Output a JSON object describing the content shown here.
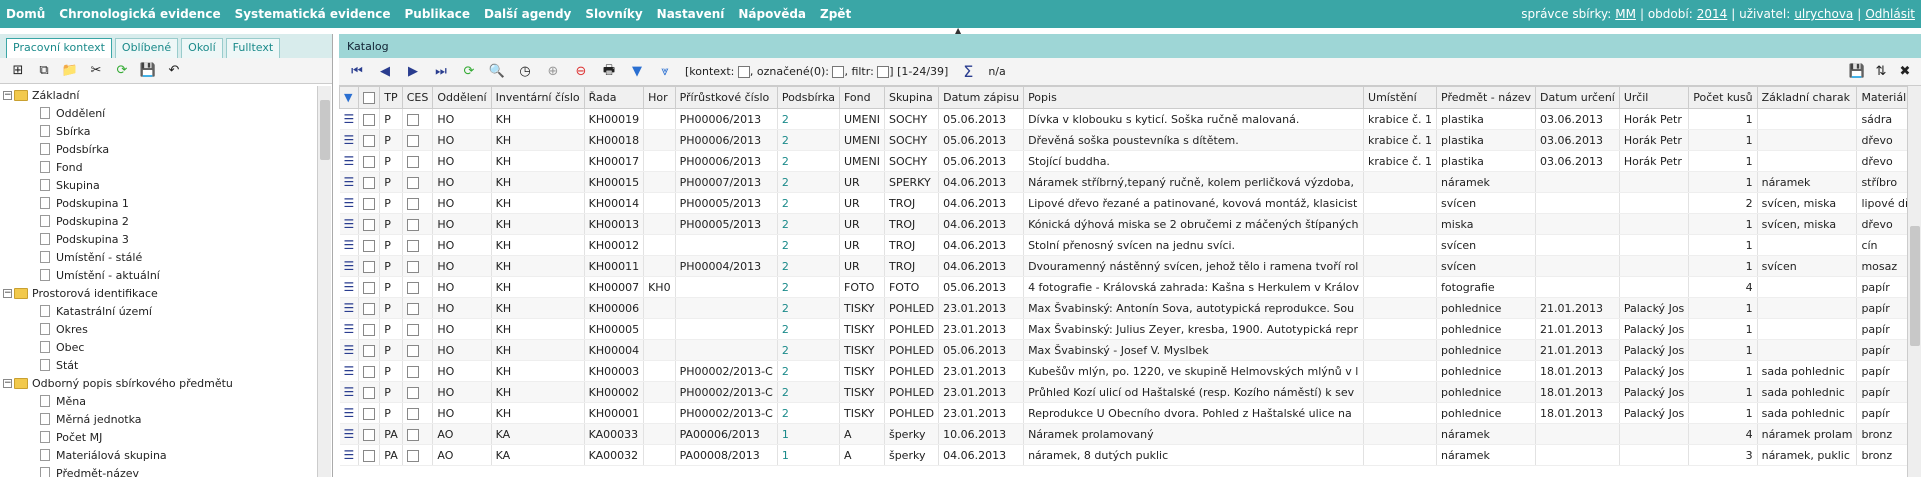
{
  "nav": {
    "items": [
      "Domů",
      "Chronologická evidence",
      "Systematická evidence",
      "Publikace",
      "Další agendy",
      "Slovníky",
      "Nastavení",
      "Nápověda",
      "Zpět"
    ],
    "admin_label": "správce sbírky:",
    "admin_value": "MM",
    "period_label": "| období:",
    "period_value": "2014",
    "user_label": "| uživatel:",
    "user_value": "ulrychova",
    "logout": "Odhlásit"
  },
  "left": {
    "tabs": [
      "Pracovní kontext",
      "Oblíbené",
      "Okolí",
      "Fulltext"
    ],
    "tree": [
      {
        "label": "Základní",
        "type": "folder"
      },
      {
        "label": "Oddělení",
        "type": "doc"
      },
      {
        "label": "Sbírka",
        "type": "doc"
      },
      {
        "label": "Podsbírka",
        "type": "doc"
      },
      {
        "label": "Fond",
        "type": "doc"
      },
      {
        "label": "Skupina",
        "type": "doc"
      },
      {
        "label": "Podskupina 1",
        "type": "doc"
      },
      {
        "label": "Podskupina 2",
        "type": "doc"
      },
      {
        "label": "Podskupina 3",
        "type": "doc"
      },
      {
        "label": "Umístění - stálé",
        "type": "doc"
      },
      {
        "label": "Umístění - aktuální",
        "type": "doc"
      },
      {
        "label": "Prostorová identifikace",
        "type": "folder"
      },
      {
        "label": "Katastrální území",
        "type": "doc"
      },
      {
        "label": "Okres",
        "type": "doc"
      },
      {
        "label": "Obec",
        "type": "doc"
      },
      {
        "label": "Stát",
        "type": "doc"
      },
      {
        "label": "Odborný popis sbírkového předmětu",
        "type": "folder"
      },
      {
        "label": "Měna",
        "type": "doc"
      },
      {
        "label": "Měrná jednotka",
        "type": "doc"
      },
      {
        "label": "Počet MJ",
        "type": "doc"
      },
      {
        "label": "Materiálová skupina",
        "type": "doc"
      },
      {
        "label": "Předmět-název",
        "type": "doc"
      }
    ]
  },
  "right": {
    "title": "Katalog",
    "toolbar_text": "[kontext:",
    "marked_text": ", označené(0):",
    "filter_text": ", filtr:",
    "range_text": "] [1-24/39]",
    "sum_text": "n/a",
    "columns": [
      "",
      "",
      "TP",
      "CES",
      "Oddělení",
      "Inventární číslo",
      "Řada",
      "Hor",
      "Přírůstkové číslo",
      "Podsbírka",
      "Fond",
      "Skupina",
      "Datum zápisu",
      "Popis",
      "Umístění",
      "Předmět - název",
      "Datum určení",
      "Určil",
      "Počet kusů",
      "Základní charak",
      "Materiál"
    ],
    "rows": [
      [
        "P",
        "HO",
        "KH",
        "KH00019",
        "",
        "PH00006/2013",
        "2",
        "UMENI",
        "SOCHY",
        "05.06.2013",
        "Dívka v klobouku s kyticí. Soška ručně malovaná.",
        "krabice č. 1",
        "plastika",
        "03.06.2013",
        "Horák Petr",
        "1",
        "",
        "sádra"
      ],
      [
        "P",
        "HO",
        "KH",
        "KH00018",
        "",
        "PH00006/2013",
        "2",
        "UMENI",
        "SOCHY",
        "05.06.2013",
        "Dřevěná soška poustevníka s dítětem.",
        "krabice č. 1",
        "plastika",
        "03.06.2013",
        "Horák Petr",
        "1",
        "",
        "dřevo"
      ],
      [
        "P",
        "HO",
        "KH",
        "KH00017",
        "",
        "PH00006/2013",
        "2",
        "UMENI",
        "SOCHY",
        "05.06.2013",
        "Stojící buddha.",
        "krabice č. 1",
        "plastika",
        "03.06.2013",
        "Horák Petr",
        "1",
        "",
        "dřevo"
      ],
      [
        "P",
        "HO",
        "KH",
        "KH00015",
        "",
        "PH00007/2013",
        "2",
        "UR",
        "SPERKY",
        "04.06.2013",
        "Náramek stříbrný,tepaný ručně, kolem perličková výzdoba,",
        "",
        "náramek",
        "",
        "",
        "1",
        "náramek",
        "stříbro"
      ],
      [
        "P",
        "HO",
        "KH",
        "KH00014",
        "",
        "PH00005/2013",
        "2",
        "UR",
        "TROJ",
        "04.06.2013",
        "Lipové dřevo řezané a patinované, kovová montáž, klasicist",
        "",
        "svícen",
        "",
        "",
        "2",
        "svícen, miska",
        "lipové dř"
      ],
      [
        "P",
        "HO",
        "KH",
        "KH00013",
        "",
        "PH00005/2013",
        "2",
        "UR",
        "TROJ",
        "04.06.2013",
        "Kónická dýhová miska se 2 obručemi z máčených štípaných",
        "",
        "miska",
        "",
        "",
        "1",
        "svícen, miska",
        "dřevo"
      ],
      [
        "P",
        "HO",
        "KH",
        "KH00012",
        "",
        "",
        "2",
        "UR",
        "TROJ",
        "04.06.2013",
        "Stolní přenosný svícen na jednu svíci.",
        "",
        "svícen",
        "",
        "",
        "1",
        "",
        "cín"
      ],
      [
        "P",
        "HO",
        "KH",
        "KH00011",
        "",
        "PH00004/2013",
        "2",
        "UR",
        "TROJ",
        "04.06.2013",
        "Dvouramenný nástěnný svícen, jehož tělo i ramena tvoří rol",
        "",
        "svícen",
        "",
        "",
        "1",
        "svícen",
        "mosaz"
      ],
      [
        "P",
        "HO",
        "KH",
        "KH00007",
        "KH0",
        "",
        "2",
        "FOTO",
        "FOTO",
        "05.06.2013",
        "4 fotografie - Královská zahrada: Kašna s Herkulem v Králov",
        "",
        "fotografie",
        "",
        "",
        "4",
        "",
        "papír"
      ],
      [
        "P",
        "HO",
        "KH",
        "KH00006",
        "",
        "",
        "2",
        "TISKY",
        "POHLED",
        "23.01.2013",
        "Max Švabinský: Antonín Sova, autotypická reprodukce. Sou",
        "",
        "pohlednice",
        "21.01.2013",
        "Palacký Jos",
        "1",
        "",
        "papír"
      ],
      [
        "P",
        "HO",
        "KH",
        "KH00005",
        "",
        "",
        "2",
        "TISKY",
        "POHLED",
        "23.01.2013",
        "Max Švabinský: Julius Zeyer, kresba, 1900. Autotypická repr",
        "",
        "pohlednice",
        "21.01.2013",
        "Palacký Jos",
        "1",
        "",
        "papír"
      ],
      [
        "P",
        "HO",
        "KH",
        "KH00004",
        "",
        "",
        "2",
        "TISKY",
        "POHLED",
        "05.06.2013",
        "Max Švabinský - Josef V. Myslbek",
        "",
        "pohlednice",
        "21.01.2013",
        "Palacký Jos",
        "1",
        "",
        "papír"
      ],
      [
        "P",
        "HO",
        "KH",
        "KH00003",
        "",
        "PH00002/2013-C",
        "2",
        "TISKY",
        "POHLED",
        "23.01.2013",
        "Kubešův mlýn, po. 1220, ve skupině Helmovských mlýnů v l",
        "",
        "pohlednice",
        "18.01.2013",
        "Palacký Jos",
        "1",
        "sada pohlednic",
        "papír"
      ],
      [
        "P",
        "HO",
        "KH",
        "KH00002",
        "",
        "PH00002/2013-C",
        "2",
        "TISKY",
        "POHLED",
        "23.01.2013",
        "Průhled Kozí ulicí od Haštalské (resp. Kozího náměstí) k sev",
        "",
        "pohlednice",
        "18.01.2013",
        "Palacký Jos",
        "1",
        "sada pohlednic",
        "papír"
      ],
      [
        "P",
        "HO",
        "KH",
        "KH00001",
        "",
        "PH00002/2013-C",
        "2",
        "TISKY",
        "POHLED",
        "23.01.2013",
        "Reprodukce U Obecního dvora. Pohled z Haštalské ulice na",
        "",
        "pohlednice",
        "18.01.2013",
        "Palacký Jos",
        "1",
        "sada pohlednic",
        "papír"
      ],
      [
        "PA",
        "AO",
        "KA",
        "KA00033",
        "",
        "PA00006/2013",
        "1",
        "A",
        "šperky",
        "10.06.2013",
        "Náramek prolamovaný",
        "",
        "náramek",
        "",
        "",
        "4",
        "náramek prolam",
        "bronz"
      ],
      [
        "PA",
        "AO",
        "KA",
        "KA00032",
        "",
        "PA00008/2013",
        "1",
        "A",
        "šperky",
        "04.06.2013",
        "náramek, 8 dutých puklic",
        "",
        "náramek",
        "",
        "",
        "3",
        "náramek, puklic",
        "bronz"
      ]
    ]
  }
}
